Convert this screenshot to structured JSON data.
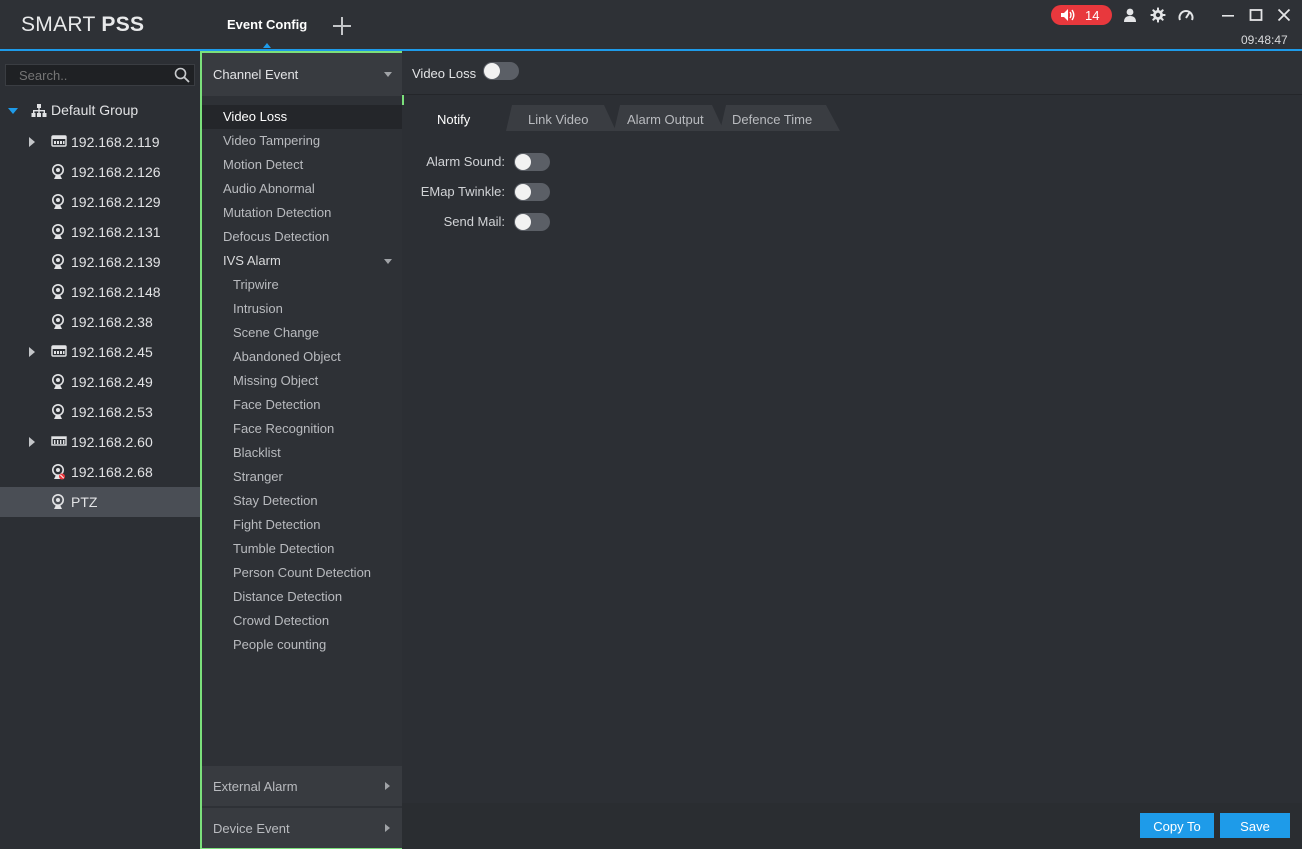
{
  "app": {
    "logo_thin": "SMART",
    "logo_bold": "PSS",
    "active_tab": "Event Config",
    "alarm_count": "14",
    "clock": "09:48:47",
    "accent_color": "#1e9be9",
    "alarm_color": "#e8383d"
  },
  "tree": {
    "search_placeholder": "Search..",
    "group_label": "Default Group",
    "devices": [
      {
        "label": "192.168.2.119",
        "icon": "nvr-icon",
        "expandable": true
      },
      {
        "label": "192.168.2.126",
        "icon": "camera-icon",
        "expandable": false
      },
      {
        "label": "192.168.2.129",
        "icon": "camera-icon",
        "expandable": false
      },
      {
        "label": "192.168.2.131",
        "icon": "camera-icon",
        "expandable": false
      },
      {
        "label": "192.168.2.139",
        "icon": "camera-icon",
        "expandable": false
      },
      {
        "label": "192.168.2.148",
        "icon": "camera-icon",
        "expandable": false
      },
      {
        "label": "192.168.2.38",
        "icon": "camera-icon",
        "expandable": false
      },
      {
        "label": "192.168.2.45",
        "icon": "nvr-icon",
        "expandable": true
      },
      {
        "label": "192.168.2.49",
        "icon": "camera-icon",
        "expandable": false
      },
      {
        "label": "192.168.2.53",
        "icon": "camera-icon",
        "expandable": false
      },
      {
        "label": "192.168.2.60",
        "icon": "dvr-icon",
        "expandable": true
      },
      {
        "label": "192.168.2.68",
        "icon": "camera-offline-icon",
        "expandable": false
      },
      {
        "label": "PTZ",
        "icon": "camera-icon",
        "expandable": false,
        "selected": true
      }
    ]
  },
  "events": {
    "header": "Channel Event",
    "items": [
      "Video Loss",
      "Video Tampering",
      "Motion Detect",
      "Audio Abnormal",
      "Mutation Detection",
      "Defocus Detection",
      "IVS Alarm"
    ],
    "ivs_items": [
      "Tripwire",
      "Intrusion",
      "Scene Change",
      "Abandoned Object",
      "Missing Object",
      "Face Detection",
      "Face Recognition",
      "Blacklist",
      "Stranger",
      "Stay Detection",
      "Fight Detection",
      "Tumble Detection",
      "Person Count Detection",
      "Distance Detection",
      "Crowd Detection",
      "People counting"
    ],
    "external_alarm": "External Alarm",
    "device_event": "Device Event"
  },
  "config": {
    "title": "Video Loss",
    "tabs": [
      "Notify",
      "Link Video",
      "Alarm Output",
      "Defence Time"
    ],
    "settings": [
      {
        "label": "Alarm Sound:",
        "on": false
      },
      {
        "label": "EMap Twinkle:",
        "on": false
      },
      {
        "label": "Send Mail:",
        "on": false
      }
    ],
    "copy_to": "Copy To",
    "save": "Save"
  }
}
